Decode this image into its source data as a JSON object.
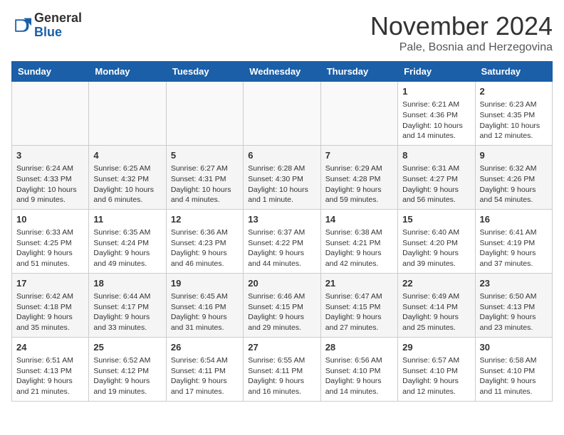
{
  "logo": {
    "general": "General",
    "blue": "Blue"
  },
  "header": {
    "month": "November 2024",
    "location": "Pale, Bosnia and Herzegovina"
  },
  "days_of_week": [
    "Sunday",
    "Monday",
    "Tuesday",
    "Wednesday",
    "Thursday",
    "Friday",
    "Saturday"
  ],
  "weeks": [
    [
      {
        "day": "",
        "info": ""
      },
      {
        "day": "",
        "info": ""
      },
      {
        "day": "",
        "info": ""
      },
      {
        "day": "",
        "info": ""
      },
      {
        "day": "",
        "info": ""
      },
      {
        "day": "1",
        "info": "Sunrise: 6:21 AM\nSunset: 4:36 PM\nDaylight: 10 hours and 14 minutes."
      },
      {
        "day": "2",
        "info": "Sunrise: 6:23 AM\nSunset: 4:35 PM\nDaylight: 10 hours and 12 minutes."
      }
    ],
    [
      {
        "day": "3",
        "info": "Sunrise: 6:24 AM\nSunset: 4:33 PM\nDaylight: 10 hours and 9 minutes."
      },
      {
        "day": "4",
        "info": "Sunrise: 6:25 AM\nSunset: 4:32 PM\nDaylight: 10 hours and 6 minutes."
      },
      {
        "day": "5",
        "info": "Sunrise: 6:27 AM\nSunset: 4:31 PM\nDaylight: 10 hours and 4 minutes."
      },
      {
        "day": "6",
        "info": "Sunrise: 6:28 AM\nSunset: 4:30 PM\nDaylight: 10 hours and 1 minute."
      },
      {
        "day": "7",
        "info": "Sunrise: 6:29 AM\nSunset: 4:28 PM\nDaylight: 9 hours and 59 minutes."
      },
      {
        "day": "8",
        "info": "Sunrise: 6:31 AM\nSunset: 4:27 PM\nDaylight: 9 hours and 56 minutes."
      },
      {
        "day": "9",
        "info": "Sunrise: 6:32 AM\nSunset: 4:26 PM\nDaylight: 9 hours and 54 minutes."
      }
    ],
    [
      {
        "day": "10",
        "info": "Sunrise: 6:33 AM\nSunset: 4:25 PM\nDaylight: 9 hours and 51 minutes."
      },
      {
        "day": "11",
        "info": "Sunrise: 6:35 AM\nSunset: 4:24 PM\nDaylight: 9 hours and 49 minutes."
      },
      {
        "day": "12",
        "info": "Sunrise: 6:36 AM\nSunset: 4:23 PM\nDaylight: 9 hours and 46 minutes."
      },
      {
        "day": "13",
        "info": "Sunrise: 6:37 AM\nSunset: 4:22 PM\nDaylight: 9 hours and 44 minutes."
      },
      {
        "day": "14",
        "info": "Sunrise: 6:38 AM\nSunset: 4:21 PM\nDaylight: 9 hours and 42 minutes."
      },
      {
        "day": "15",
        "info": "Sunrise: 6:40 AM\nSunset: 4:20 PM\nDaylight: 9 hours and 39 minutes."
      },
      {
        "day": "16",
        "info": "Sunrise: 6:41 AM\nSunset: 4:19 PM\nDaylight: 9 hours and 37 minutes."
      }
    ],
    [
      {
        "day": "17",
        "info": "Sunrise: 6:42 AM\nSunset: 4:18 PM\nDaylight: 9 hours and 35 minutes."
      },
      {
        "day": "18",
        "info": "Sunrise: 6:44 AM\nSunset: 4:17 PM\nDaylight: 9 hours and 33 minutes."
      },
      {
        "day": "19",
        "info": "Sunrise: 6:45 AM\nSunset: 4:16 PM\nDaylight: 9 hours and 31 minutes."
      },
      {
        "day": "20",
        "info": "Sunrise: 6:46 AM\nSunset: 4:15 PM\nDaylight: 9 hours and 29 minutes."
      },
      {
        "day": "21",
        "info": "Sunrise: 6:47 AM\nSunset: 4:15 PM\nDaylight: 9 hours and 27 minutes."
      },
      {
        "day": "22",
        "info": "Sunrise: 6:49 AM\nSunset: 4:14 PM\nDaylight: 9 hours and 25 minutes."
      },
      {
        "day": "23",
        "info": "Sunrise: 6:50 AM\nSunset: 4:13 PM\nDaylight: 9 hours and 23 minutes."
      }
    ],
    [
      {
        "day": "24",
        "info": "Sunrise: 6:51 AM\nSunset: 4:13 PM\nDaylight: 9 hours and 21 minutes."
      },
      {
        "day": "25",
        "info": "Sunrise: 6:52 AM\nSunset: 4:12 PM\nDaylight: 9 hours and 19 minutes."
      },
      {
        "day": "26",
        "info": "Sunrise: 6:54 AM\nSunset: 4:11 PM\nDaylight: 9 hours and 17 minutes."
      },
      {
        "day": "27",
        "info": "Sunrise: 6:55 AM\nSunset: 4:11 PM\nDaylight: 9 hours and 16 minutes."
      },
      {
        "day": "28",
        "info": "Sunrise: 6:56 AM\nSunset: 4:10 PM\nDaylight: 9 hours and 14 minutes."
      },
      {
        "day": "29",
        "info": "Sunrise: 6:57 AM\nSunset: 4:10 PM\nDaylight: 9 hours and 12 minutes."
      },
      {
        "day": "30",
        "info": "Sunrise: 6:58 AM\nSunset: 4:10 PM\nDaylight: 9 hours and 11 minutes."
      }
    ]
  ]
}
